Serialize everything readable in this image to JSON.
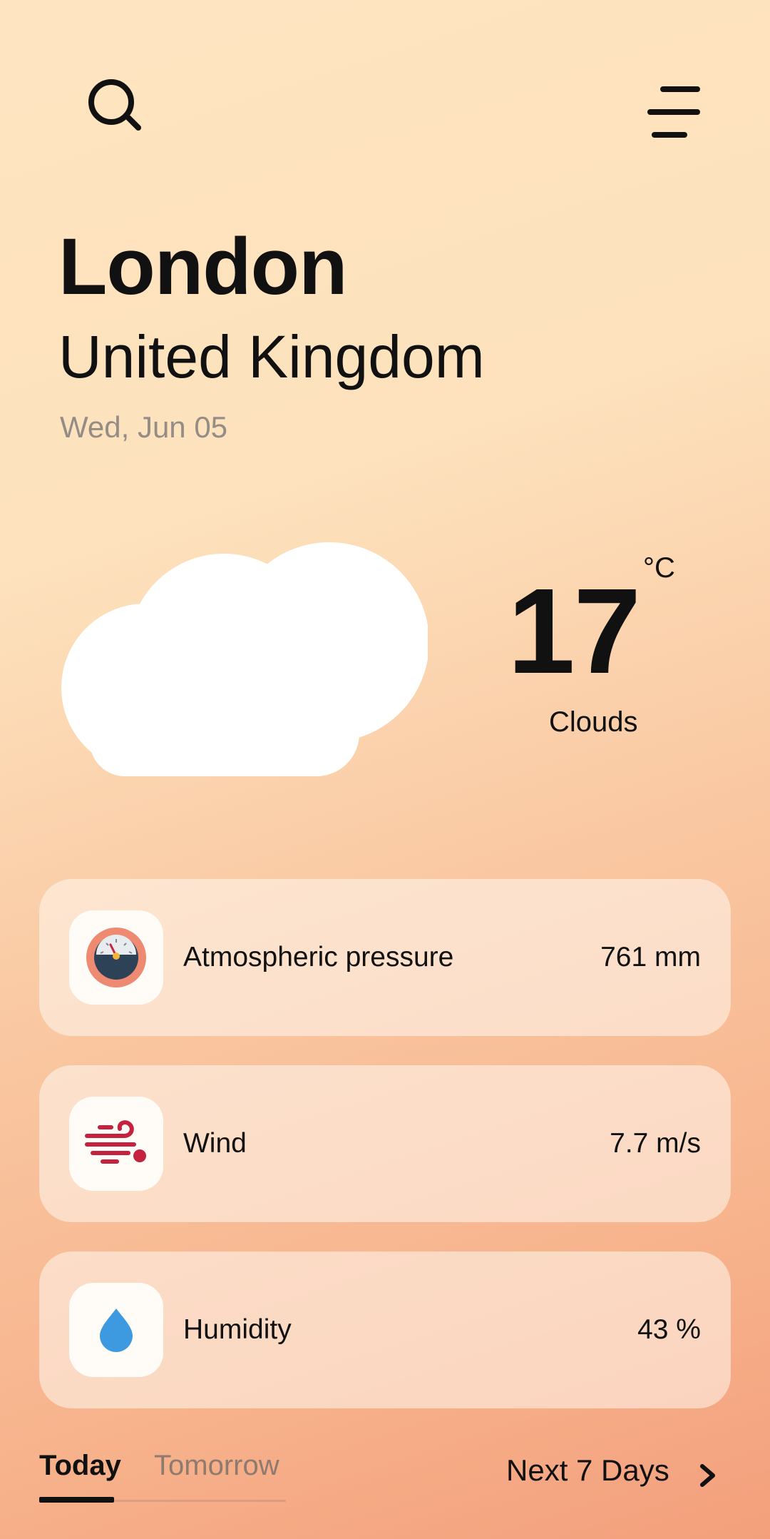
{
  "header": {
    "search_icon": "search-icon",
    "menu_icon": "menu-icon"
  },
  "location": {
    "city": "London",
    "country": "United Kingdom",
    "date": "Wed, Jun 05"
  },
  "current": {
    "icon": "cloud-icon",
    "temperature": "17",
    "unit": "°C",
    "condition": "Clouds"
  },
  "details": [
    {
      "icon": "barometer-icon",
      "label": "Atmospheric pressure",
      "value": "761 mm"
    },
    {
      "icon": "wind-icon",
      "label": "Wind",
      "value": "7.7 m/s"
    },
    {
      "icon": "water-drop-icon",
      "label": "Humidity",
      "value": "43 %"
    }
  ],
  "tabs": {
    "today": "Today",
    "tomorrow": "Tomorrow",
    "selected": "Today"
  },
  "forecast_link": {
    "label": "Next 7 Days",
    "icon": "chevron-right-icon"
  },
  "colors": {
    "background_top": "#fee4c0",
    "background_bottom": "#f39f7c",
    "text_primary": "#111111",
    "text_muted": "#958c85",
    "barometer_ring": "#ef8a72",
    "barometer_face": "#2e4257",
    "wind": "#c4223f",
    "humidity": "#3d9ae0"
  }
}
